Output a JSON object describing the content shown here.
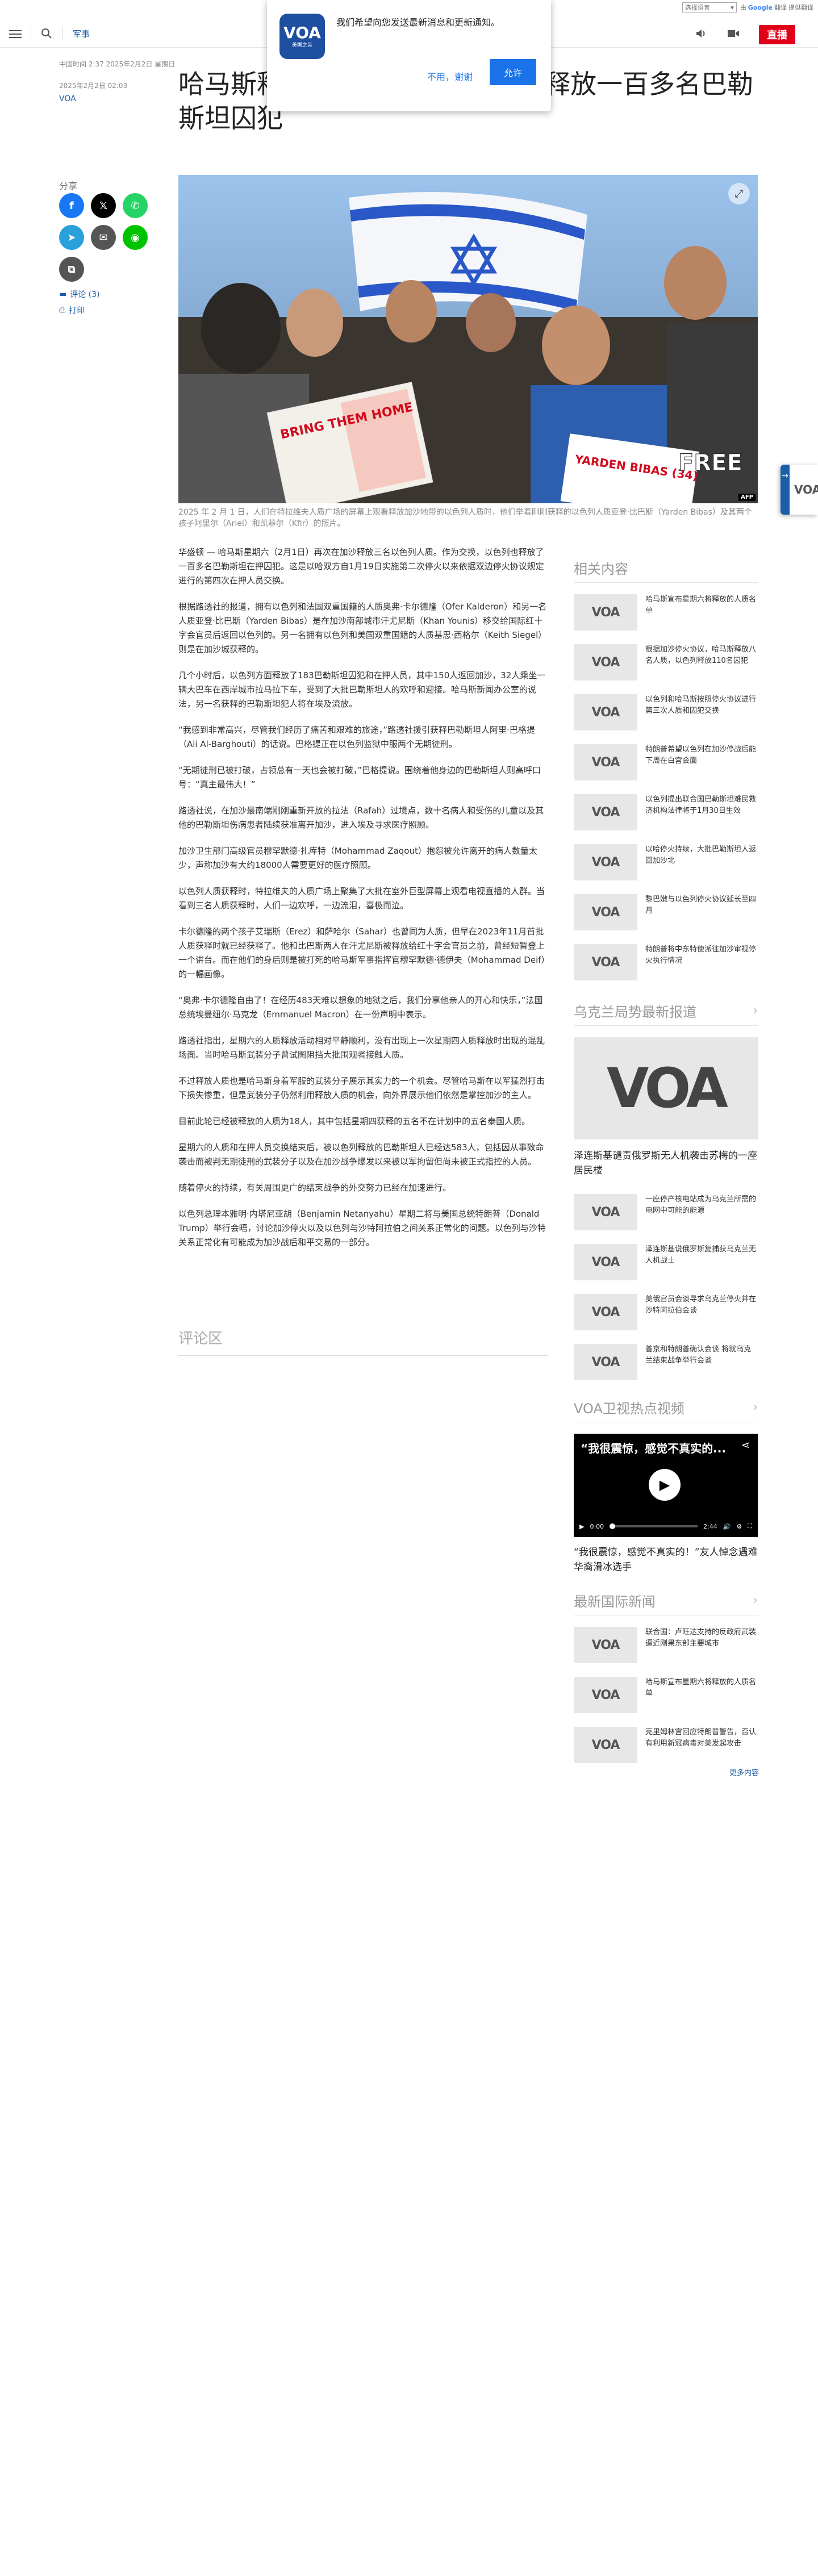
{
  "translate": {
    "select": "选择语言",
    "powered": "由",
    "google": "Google",
    "translate_word": "翻译",
    "by": "提供翻译"
  },
  "header": {
    "section": "军事",
    "live": "直播"
  },
  "notification": {
    "logo": "VOA",
    "logo_sub": "美国之音",
    "text": "我们希望向您发送最新消息和更新通知。",
    "no": "不用，谢谢",
    "yes": "允许"
  },
  "meta": {
    "time": "中国时间 2:37 2025年2月2日 星期日",
    "date": "2025年2月2日 02:03",
    "author": "VOA"
  },
  "headline": "哈马斯释放以色列人质和以色列释放一百多名巴勒斯坦囚犯",
  "share": {
    "label": "分享",
    "comments": "评论 (3)",
    "print": "打印"
  },
  "hero": {
    "sign1": "BRING THEM HOME",
    "sign2": "YARDEN BIBAS (34)",
    "sign3": "FREE",
    "afp": "AFP"
  },
  "caption": "2025 年 2 月 1 日，人们在特拉维夫人质广场的屏幕上观看释放加沙地带的以色列人质时，他们举着刚刚获释的以色列人质亚登·比巴斯（Yarden Bibas）及其两个孩子阿里尔（Ariel）和凯菲尔（Kfir）的照片。",
  "article": [
    "华盛顿 — 哈马斯星期六（2月1日）再次在加沙释放三名以色列人质。作为交换，以色列也释放了一百多名巴勒斯坦在押囚犯。这是以哈双方自1月19日实施第二次停火以来依据双边停火协议规定进行的第四次在押人员交换。",
    "根据路透社的报道，拥有以色列和法国双重国籍的人质奥弗·卡尔德隆（Ofer Kalderon）和另一名人质亚登·比巴斯（Yarden Bibas）是在加沙南部城市汗尤尼斯（Khan Younis）移交给国际红十字会官员后返回以色列的。另一名拥有以色列和美国双重国籍的人质基思·西格尔（Keith Siegel）则是在加沙城获释的。",
    "几个小时后，以色列方面释放了183巴勒斯坦囚犯和在押人员，其中150人返回加沙，32人乘坐一辆大巴车在西岸城市拉马拉下车，受到了大批巴勒斯坦人的欢呼和迎接。哈马斯新闻办公室的说法，另一名获释的巴勒斯坦犯人将在埃及流放。",
    "“我感到非常高兴，尽管我们经历了痛苦和艰难的旅途，”路透社援引获释巴勒斯坦人阿里·巴格提（Ali Al-Barghouti）的话说。巴格提正在以色列监狱中服两个无期徒刑。",
    "“无期徒刑已被打破，占领总有一天也会被打破，”巴格提说。围绕着他身边的巴勒斯坦人则高呼口号：“真主最伟大！”",
    "路透社说，在加沙最南端刚刚重新开放的拉法（Rafah）过境点，数十名病人和受伤的儿童以及其他的巴勒斯坦伤病患者陆续获准离开加沙，进入埃及寻求医疗照顾。",
    "加沙卫生部门高级官员穆罕默德·扎库特（Mohammad Zaqout）抱怨被允许离开的病人数量太少，声称加沙有大约18000人需要更好的医疗照顾。",
    "以色列人质获释时，特拉维夫的人质广场上聚集了大批在室外巨型屏幕上观看电视直播的人群。当看到三名人质获释时，人们一边欢呼，一边流泪，喜极而泣。",
    "卡尔德隆的两个孩子艾瑞斯（Erez）和萨哈尔（Sahar）也曾同为人质，但早在2023年11月首批人质获释时就已经获释了。他和比巴斯两人在汗尤尼斯被释放给红十字会官员之前，曾经短暂登上一个讲台。而在他们的身后则是被打死的哈马斯军事指挥官穆罕默德·德伊夫（Mohammad Deif）的一幅画像。",
    "“奥弗·卡尔德隆自由了！在经历483天难以想象的地狱之后，我们分享他亲人的开心和快乐，”法国总统埃曼纽尔·马克龙（Emmanuel Macron）在一份声明中表示。",
    "路透社指出，星期六的人质释放活动相对平静顺利，没有出现上一次星期四人质释放时出现的混乱场面。当时哈马斯武装分子曾试图阻挡大批围观者接触人质。",
    "不过释放人质也是哈马斯身着军服的武装分子展示其实力的一个机会。尽管哈马斯在以军猛烈打击下损失惨重，但是武装分子仍然利用释放人质的机会，向外界展示他们依然是掌控加沙的主人。",
    "目前此轮已经被释放的人质为18人，其中包括星期四获释的五名不在计划中的五名泰国人质。",
    "星期六的人质和在押人员交换结束后，被以色列释放的巴勒斯坦人已经达583人，包括因从事致命袭击而被判无期徒刑的武装分子以及在加沙战争爆发以来被以军拘留但尚未被正式指控的人员。",
    "随着停火的持续，有关周围更广的结束战争的外交努力已经在加速进行。",
    "以色列总理本雅明·内塔尼亚胡（Benjamin Netanyahu）星期二将与美国总统特朗普（Donald Trump）举行会晤，讨论加沙停火以及以色列与沙特阿拉伯之间关系正常化的问题。以色列与沙特关系正常化有可能成为加沙战后和平交易的一部分。"
  ],
  "comments_heading": "评论区",
  "related": {
    "heading": "相关内容",
    "items": [
      "哈马斯宣布星期六将释放的人质名单",
      "根据加沙停火协议，哈马斯释放八名人质，以色列释放110名囚犯",
      "以色列和哈马斯按照停火协议进行第三次人质和囚犯交换",
      "特朗普希望以色列在加沙停战后能下周在白宫会面",
      "以色列提出联合国巴勒斯坦难民救济机构法律将于1月30日生效",
      "以哈停火持续，大批巴勒斯坦人返回加沙北",
      "黎巴嫩与以色列停火协议延长至四月",
      "特朗普将中东特使派往加沙审视停火执行情况"
    ]
  },
  "ukraine": {
    "heading": "乌克兰局势最新报道",
    "lead": "泽连斯基谴责俄罗斯无人机袭击苏梅的一座居民楼",
    "items": [
      "一座停产核电站成为乌克兰所需的电网中可能的能源",
      "泽连斯基说俄罗斯复捕获乌克兰无人机战士",
      "美俄官员会谈寻求乌克兰停火并在沙特阿拉伯会谈",
      "普京和特朗普确认会谈 将就乌克兰结束战争举行会谈"
    ]
  },
  "video": {
    "heading": "VOA卫视热点视频",
    "title": "“我很震惊，感觉不真实的...",
    "time_cur": "0:00",
    "time_total": "2:44",
    "caption": "“我很震惊，感觉不真实的！”友人悼念遇难华裔滑冰选手"
  },
  "international": {
    "heading": "最新国际新闻",
    "items": [
      "联合国：卢旺达支持的反政府武装逼近刚果东部主要城市",
      "哈马斯宣布星期六将释放的人质名单",
      "克里姆林宫回应特朗普警告，否认有利用新冠病毒对美发起攻击"
    ],
    "more": "更多内容"
  },
  "float": {
    "logo": "VOA"
  }
}
